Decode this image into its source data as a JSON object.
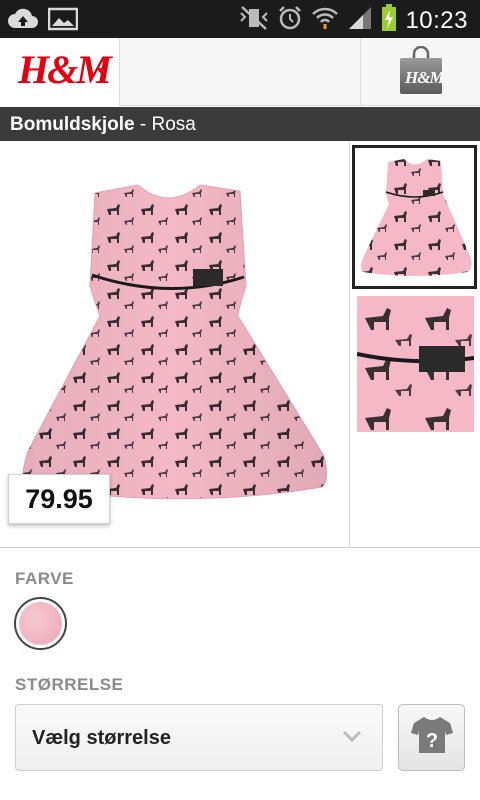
{
  "status_bar": {
    "time": "10:23",
    "icons": [
      "cloud-upload-icon",
      "image-icon",
      "vibrate-mute-icon",
      "alarm-icon",
      "wifi-icon",
      "signal-icon",
      "battery-charging-icon"
    ]
  },
  "header": {
    "logo": "H&M",
    "bag_logo": "H&M"
  },
  "product": {
    "name": "Bomuldskjole",
    "separator": " - ",
    "color_name": "Rosa",
    "price": "79.95"
  },
  "options": {
    "color_label": "FARVE",
    "size_label": "STØRRELSE",
    "size_placeholder": "Vælg størrelse"
  },
  "colors": {
    "brand_red": "#e50010",
    "dress_pink": "#f4b8c6",
    "title_bar": "#3b3b3b"
  }
}
